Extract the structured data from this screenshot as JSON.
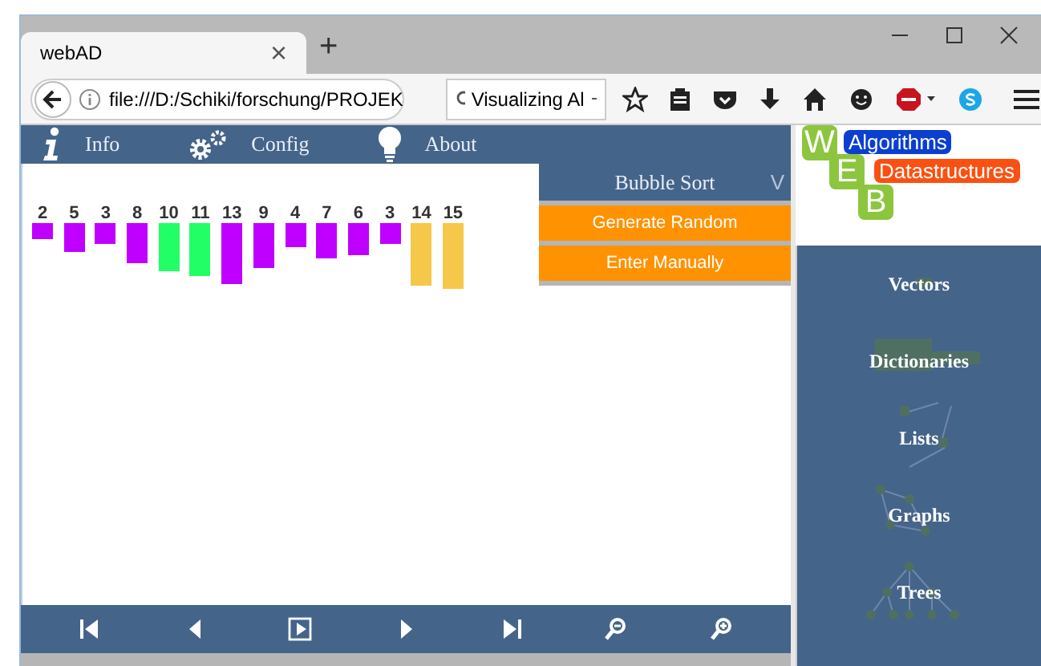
{
  "browser": {
    "tab": {
      "title": "webAD",
      "close": "×",
      "selected": true
    },
    "new_tab": "+",
    "address": "file:///D:/Schiki/forschung/PROJEK",
    "search": "Visualizing Al"
  },
  "menu": [
    {
      "label": "Info"
    },
    {
      "label": "Config"
    },
    {
      "label": "About"
    }
  ],
  "bars": [
    {
      "label": "2",
      "color": "#bf00ff"
    },
    {
      "label": "5",
      "color": "#bf00ff"
    },
    {
      "label": "3",
      "color": "#bf00ff"
    },
    {
      "label": "8",
      "color": "#bf00ff"
    },
    {
      "label": "10",
      "color": "#22ff66"
    },
    {
      "label": "11",
      "color": "#22ff66"
    },
    {
      "label": "13",
      "color": "#bf00ff"
    },
    {
      "label": "9",
      "color": "#bf00ff"
    },
    {
      "label": "4",
      "color": "#bf00ff"
    },
    {
      "label": "7",
      "color": "#bf00ff"
    },
    {
      "label": "6",
      "color": "#bf00ff"
    },
    {
      "label": "3",
      "color": "#bf00ff"
    },
    {
      "label": "14",
      "color": "#f5c84a"
    },
    {
      "label": "15",
      "color": "#f5c84a"
    }
  ],
  "algorithm": {
    "title": "Bubble Sort",
    "toggle": "V",
    "buttons": [
      "Generate Random",
      "Enter Manually"
    ]
  },
  "logo": {
    "letters": [
      "W",
      "E",
      "B"
    ],
    "tags": [
      {
        "text": "Algorithms",
        "color": "#0b3fcf"
      },
      {
        "text": "Datastructures",
        "color": "#fa5012"
      }
    ]
  },
  "categories": [
    {
      "label": "Vectors"
    },
    {
      "label": "Dictionaries"
    },
    {
      "label": "Lists"
    },
    {
      "label": "Graphs"
    },
    {
      "label": "Trees"
    }
  ]
}
